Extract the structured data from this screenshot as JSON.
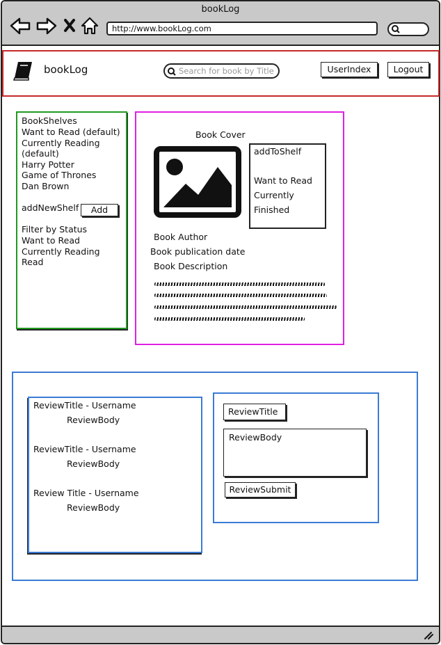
{
  "browser": {
    "title": "bookLog",
    "url": "http://www.bookLog.com",
    "icons": [
      "back-arrow-icon",
      "forward-arrow-icon",
      "close-x-icon",
      "home-icon",
      "search-icon"
    ]
  },
  "header": {
    "logo_text": "bookLog",
    "search_placeholder": "Search for book by Title",
    "user_index_label": "UserIndex",
    "logout_label": "Logout"
  },
  "shelves": {
    "heading": "BookShelves",
    "items": [
      "Want to Read (default)",
      "Currently Reading",
      "(default)",
      "Harry Potter",
      "Game of Thrones",
      "Dan Brown"
    ],
    "add_label": "addNewShelf",
    "add_button": "Add",
    "filter_heading": "Filter by Status",
    "filters": [
      "Want to Read",
      "Currently Reading",
      "Read"
    ]
  },
  "book": {
    "cover_label": "Book Cover",
    "shelf_heading": "addToShelf",
    "shelf_options": [
      "Want to Read",
      "Currently",
      "Finished"
    ],
    "author": "Book Author",
    "date": "Book publication date",
    "description": "Book Description"
  },
  "reviews": {
    "items": [
      {
        "title": "ReviewTitle - Username",
        "body": "ReviewBody"
      },
      {
        "title": "ReviewTitle - Username",
        "body": "ReviewBody"
      },
      {
        "title": "Review Title - Username",
        "body": "ReviewBody"
      }
    ],
    "form": {
      "title_placeholder": "ReviewTitle",
      "body_placeholder": "ReviewBody",
      "submit_label": "ReviewSubmit"
    }
  },
  "colors": {
    "header_border": "#c62828",
    "shelves_border": "#1f9a1f",
    "book_border": "#e020e0",
    "reviews_border": "#3a7bd5",
    "browser_chrome": "#c9c9c9"
  }
}
